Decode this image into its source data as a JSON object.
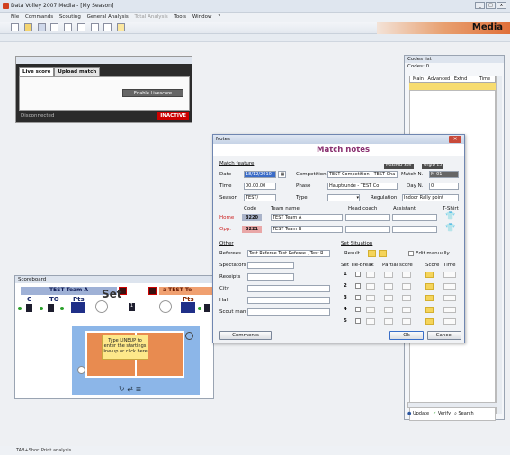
{
  "window": {
    "title": "Data Volley 2007 Media - [My Season]",
    "brand": "Media"
  },
  "menu": {
    "items": [
      "File",
      "Commands",
      "Scouting",
      "General Analysis",
      "Total Analysis",
      "Tools",
      "Window",
      "?"
    ]
  },
  "live": {
    "tab_live": "Live score",
    "tab_upload": "Upload match",
    "enable_label": "Enable Livescore",
    "status": "Disconnected",
    "badge": "INACTIVE"
  },
  "codes": {
    "title": "Codes list",
    "count_label": "Codes:",
    "count": "0",
    "col_main": "Main",
    "col_advanced": "Advanced",
    "col_extnd": "Extnd",
    "col_time": "Time",
    "update": "Update",
    "verify": "Verify",
    "search": "Search"
  },
  "scoreboard": {
    "title": "Scoreboard",
    "team_a": "TEST Team A",
    "team_b": "a TEST Te",
    "set": "Set",
    "c": "C",
    "to": "TO",
    "pts": "Pts",
    "set_value": "1",
    "note": "Type LINEUP to enter the startings line-up or click here"
  },
  "notes": {
    "title": "Notes",
    "heading": "Match notes",
    "match_feature": "Match feature",
    "ids": {
      "match_id": "MatchID 439",
      "org_id": "OrgID 13"
    },
    "date_label": "Date",
    "date_value": "18/12/2010",
    "time_label": "Time",
    "time_value": "00.00.00",
    "season_label": "Season",
    "season_value": "TEST/",
    "competition_label": "Competition",
    "competition_value": "TEST Competition - TEST Cha",
    "match_n_label": "Match N.",
    "match_n_value": "M-01",
    "phase_label": "Phase",
    "phase_value": "Hauptrunde - TEST Co",
    "day_label": "Day N.",
    "day_value": "0",
    "type_label": "Type",
    "regulation_label": "Regulation",
    "regulation_value": "Indoor Rally point",
    "col_code": "Code",
    "col_team": "Team name",
    "col_coach": "Head coach",
    "col_assistant": "Assistant",
    "col_shirt": "T-Shirt",
    "home_label": "Home",
    "home_code": "3220",
    "home_team": "TEST Team A",
    "opp_label": "Opp.",
    "opp_code": "3221",
    "opp_team": "TEST Team B",
    "other": "Other",
    "referees_label": "Referees",
    "referees_value": "Test Referee  Test Referee , Test R.",
    "spectators_label": "Spectators",
    "receipts_label": "Receipts",
    "city_label": "City",
    "hall_label": "Hall",
    "scout_label": "Scout man",
    "set_situation": "Set Situation",
    "result_label": "Result",
    "edit_manually": "Edit manually",
    "set_col": "Set",
    "tiebreak_col": "Tie-Break",
    "partial_col": "Partial score",
    "score_col": "Score",
    "time_col": "Time",
    "sets": [
      "1",
      "2",
      "3",
      "4",
      "5"
    ],
    "comments_btn": "Comments",
    "ok_btn": "Ok",
    "cancel_btn": "Cancel"
  },
  "statusbar": {
    "text": "TAB+Shor. Print analysis"
  }
}
